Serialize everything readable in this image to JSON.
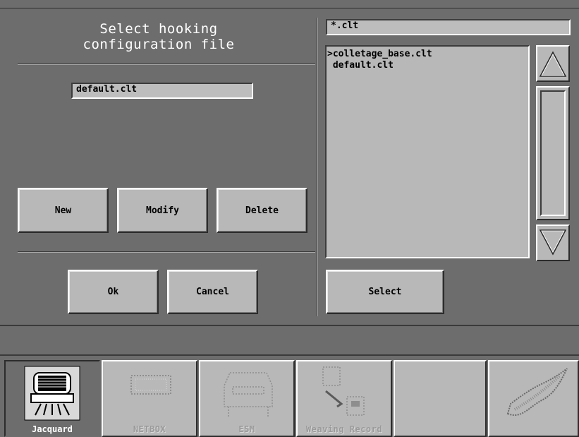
{
  "dialog": {
    "title": "Select hooking\nconfiguration file",
    "filename_value": "default.clt",
    "buttons": {
      "new": "New",
      "modify": "Modify",
      "delete": "Delete",
      "ok": "Ok",
      "cancel": "Cancel"
    }
  },
  "browser": {
    "filter": "*.clt",
    "files": [
      ">colletage_base.clt",
      " default.clt"
    ],
    "select_label": "Select"
  },
  "taskbar": {
    "tabs": [
      {
        "label": "Jacquard",
        "icon": "jacquard-machine-icon",
        "active": true,
        "enabled": true
      },
      {
        "label": "NETBOX",
        "icon": "netbox-icon",
        "active": false,
        "enabled": false
      },
      {
        "label": "ESM",
        "icon": "esm-icon",
        "active": false,
        "enabled": false
      },
      {
        "label": "Weaving Record",
        "icon": "weaving-record-icon",
        "active": false,
        "enabled": false
      },
      {
        "label": "",
        "icon": "",
        "active": false,
        "enabled": false
      },
      {
        "label": "",
        "icon": "shuttle-icon",
        "active": false,
        "enabled": false
      }
    ]
  },
  "colors": {
    "background": "#6d6d6d",
    "panel": "#b8b8b8",
    "title_text": "#ffffff"
  }
}
